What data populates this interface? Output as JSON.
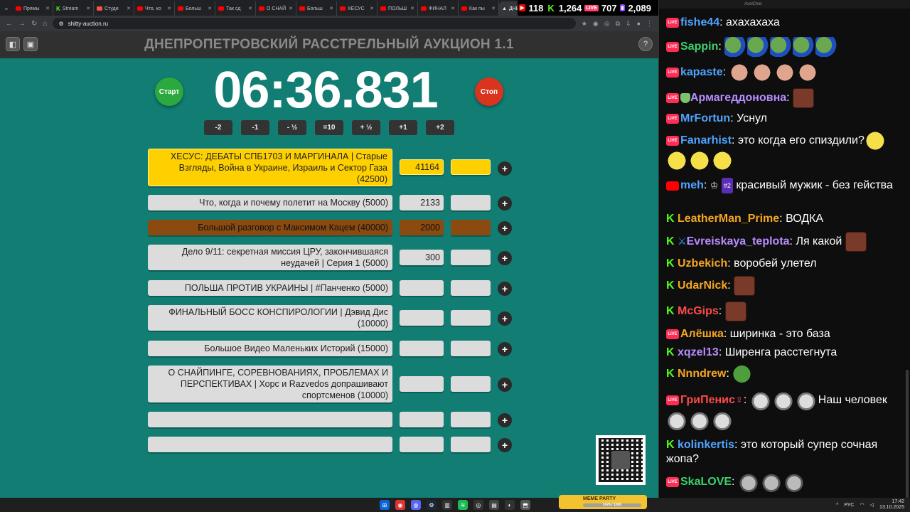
{
  "browser": {
    "tabs": [
      "Прямы",
      "Stream",
      "Студи",
      "Что, ко",
      "Больш",
      "Так сд",
      "О СНАЙ",
      "Больш",
      "ХЕСУС",
      "ПОЛЬШ",
      "ФИНАЛ",
      "Как пы",
      "ДНЕ"
    ],
    "url": "shitty-auction.ru"
  },
  "stats": {
    "youtube": "118",
    "kick": "1,264",
    "vk": "707",
    "twitch": "2,089"
  },
  "auction": {
    "title": "ДНЕПРОПЕТРОВСКИЙ РАССТРЕЛЬНЫЙ АУКЦИОН 1.1",
    "timer": "06:36.831",
    "start_label": "Старт",
    "stop_label": "Стоп",
    "adjust": [
      "-2",
      "-1",
      "- ½",
      "=10",
      "+ ½",
      "+1",
      "+2"
    ],
    "lots": [
      {
        "name": "ХЕСУС: ДЕБАТЫ СПБ1703 И МАРГИНАЛА | Старые Взгляды, Война в Украине, Израиль и Сектор Газа (42500)",
        "sum": "41164",
        "highlight": "yellow"
      },
      {
        "name": "Что, когда и почему полетит на Москву (5000)",
        "sum": "2133",
        "highlight": ""
      },
      {
        "name": "Большой разговор с Максимом Кацем (40000)",
        "sum": "2000",
        "highlight": "brown"
      },
      {
        "name": "Дело 9/11: секретная миссия ЦРУ, закончившаяся неудачей | Серия 1 (5000)",
        "sum": "300",
        "highlight": ""
      },
      {
        "name": "ПОЛЬША ПРОТИВ УКРАИНЫ | #Панченко (5000)",
        "sum": "",
        "highlight": ""
      },
      {
        "name": "ФИНАЛЬНЫЙ БОСС КОНСПИРОЛОГИИ | Дэвид Дис (10000)",
        "sum": "",
        "highlight": ""
      },
      {
        "name": "Большое Видео Маленьких Историй (15000)",
        "sum": "",
        "highlight": ""
      },
      {
        "name": "О СНАЙПИНГЕ, СОРЕВНОВАНИЯХ, ПРОБЛЕМАХ И ПЕРСПЕКТИВАХ | Хорс и Razvedos допрашивают спортсменов (10000)",
        "sum": "",
        "highlight": ""
      },
      {
        "name": "",
        "sum": "",
        "highlight": ""
      },
      {
        "name": "",
        "sum": "",
        "highlight": ""
      }
    ],
    "plus_label": "+"
  },
  "chat": {
    "header": "AxelChat",
    "messages": [
      {
        "platform": "vk",
        "nick": "fishe44",
        "color": "#4fa3ff",
        "text": "ахахахаха",
        "emotes": []
      },
      {
        "platform": "vk",
        "nick": "Sappin",
        "color": "#3bd16f",
        "text": "",
        "emotes": [
          "pepe",
          "pepe",
          "pepe",
          "pepe",
          "pepe"
        ]
      },
      {
        "platform": "vk",
        "nick": "kapaste",
        "color": "#4fa3ff",
        "text": "",
        "emotes": [
          "hand",
          "hand",
          "hand",
          "hand"
        ]
      },
      {
        "platform": "vk",
        "nick": "Армагеддоновна",
        "color": "#b78cff",
        "text": "",
        "emotes": [
          "face"
        ]
      },
      {
        "platform": "vk",
        "nick": "MrFortun",
        "color": "#4fa3ff",
        "text": "Уснул",
        "emotes": []
      },
      {
        "platform": "vk",
        "nick": "Fanarhist",
        "color": "#4fa3ff",
        "text": "это когда его спиздили?",
        "emotes": [
          "laugh",
          "laugh",
          "laugh",
          "laugh"
        ]
      },
      {
        "platform": "yt",
        "nick": "meh",
        "color": "#4fa3ff",
        "badge": "#2",
        "text": "красивый мужик - без гейства",
        "emotes": []
      },
      {
        "platform": "kick",
        "nick": "LeatherMan_Prime",
        "color": "#f5a623",
        "text": "ВОДКА",
        "emotes": []
      },
      {
        "platform": "kick",
        "nick": "Evreiskaya_teplota",
        "color": "#b78cff",
        "text": "Ля какой",
        "emotes": [
          "face"
        ]
      },
      {
        "platform": "kick",
        "nick": "Uzbekich",
        "color": "#f5a623",
        "text": "воробей улетел",
        "emotes": []
      },
      {
        "platform": "kick",
        "nick": "UdarNick",
        "color": "#f5a623",
        "text": "",
        "emotes": [
          "face"
        ]
      },
      {
        "platform": "kick",
        "nick": "McGips",
        "color": "#ff4a4a",
        "text": "",
        "emotes": [
          "face"
        ]
      },
      {
        "platform": "vk",
        "nick": "Алёшка",
        "color": "#f5a623",
        "text": "ширинка - это база",
        "emotes": []
      },
      {
        "platform": "kick",
        "nick": "xqzel13",
        "color": "#b78cff",
        "text": "Ширенга расстегнута",
        "emotes": []
      },
      {
        "platform": "kick",
        "nick": "Nnndrew",
        "color": "#f5a623",
        "text": "",
        "emotes": [
          "pepeg"
        ]
      },
      {
        "platform": "vk",
        "nick": "ГриПенис♀",
        "color": "#ff4a4a",
        "text": "Наш человек",
        "emotes": [
          "cat",
          "cat",
          "cat",
          "cat",
          "cat",
          "cat"
        ]
      },
      {
        "platform": "kick",
        "nick": "kolinkertis",
        "color": "#4fa3ff",
        "text": "это который супер сочная жопа?",
        "emotes": []
      },
      {
        "platform": "vk",
        "nick": "SkaLOVE",
        "color": "#3bd16f",
        "text": "",
        "emotes": [
          "shrug",
          "shrug",
          "shrug"
        ]
      }
    ]
  },
  "taskbar": {
    "meme_title": "MEME PARTY",
    "meme_progress_text": "1476 / 1500",
    "meme_progress": 0.98,
    "lang": "РУС",
    "time": "17:42",
    "date": "13.10.2025"
  }
}
